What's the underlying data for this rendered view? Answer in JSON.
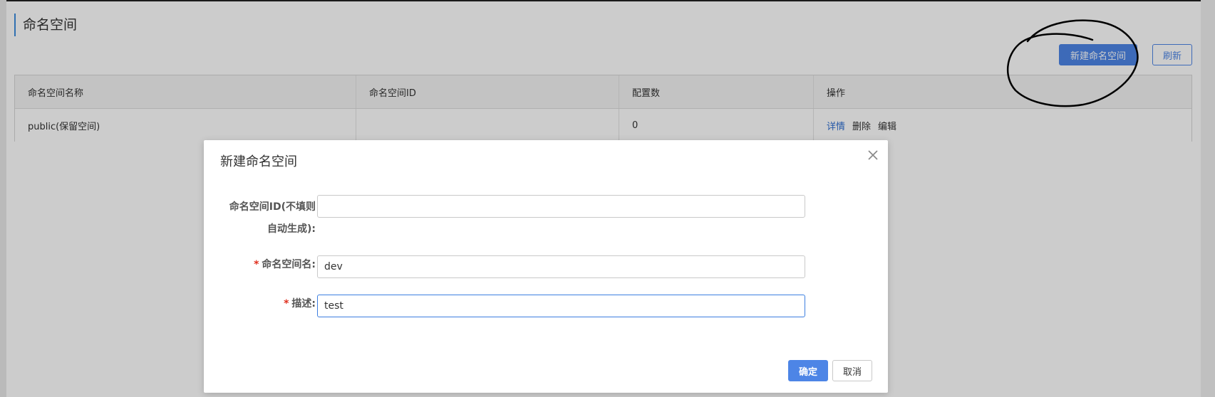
{
  "page": {
    "title": "命名空间",
    "actions": {
      "new_label": "新建命名空间",
      "refresh_label": "刷新"
    }
  },
  "table": {
    "columns": [
      "命名空间名称",
      "命名空间ID",
      "配置数",
      "操作"
    ],
    "rows": [
      {
        "name": "public(保留空间)",
        "id": "",
        "config_count": "0",
        "ops": [
          "详情",
          "删除",
          "编辑"
        ]
      }
    ]
  },
  "dialog": {
    "title": "新建命名空间",
    "fields": {
      "namespace_id": {
        "label_line1": "命名空间ID(不填则",
        "label_line2": "自动生成):",
        "value": ""
      },
      "namespace_name": {
        "required_mark": "*",
        "label": "命名空间名:",
        "value": "dev"
      },
      "description": {
        "required_mark": "*",
        "label": "描述:",
        "value": "test"
      }
    },
    "confirm_label": "确定",
    "cancel_label": "取消"
  },
  "colors": {
    "primary": "#4d85e6",
    "link": "#2f6fd2",
    "required": "#e0301e",
    "overlay": "rgba(0,0,0,0.2)"
  },
  "icons": {
    "close": "close-icon"
  }
}
